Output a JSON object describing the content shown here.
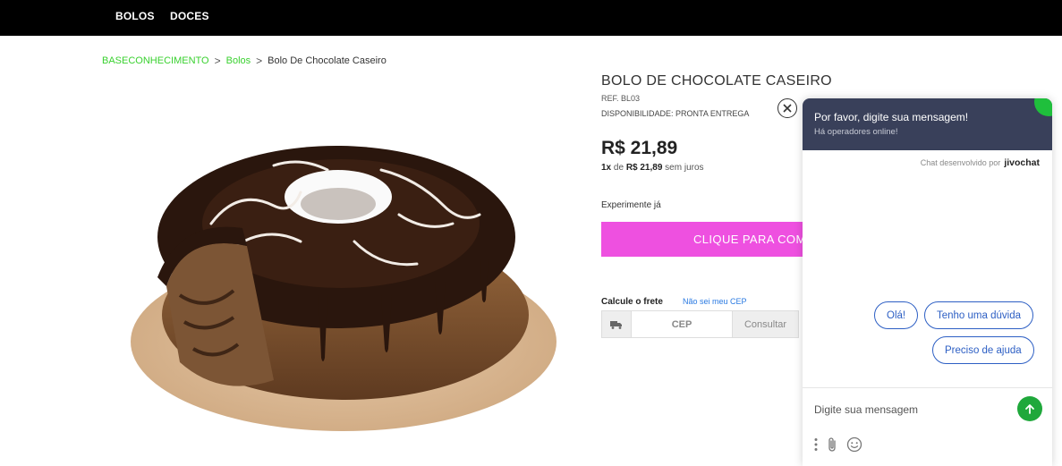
{
  "nav": {
    "items": [
      "BOLOS",
      "DOCES"
    ]
  },
  "breadcrumb": {
    "home": "BASECONHECIMENTO",
    "category": "Bolos",
    "current": "Bolo De Chocolate Caseiro",
    "separator": ">"
  },
  "product": {
    "title": "BOLO DE CHOCOLATE CASEIRO",
    "ref": "REF. BL03",
    "availability": "DISPONIBILIDADE: PRONTA ENTREGA",
    "price": "R$ 21,89",
    "install_prefix": "1x",
    "install_de": " de ",
    "install_value": "R$ 21,89",
    "install_suffix": " sem juros",
    "try_label": "Experimente já",
    "buy_label": "CLIQUE PARA COM"
  },
  "shipping": {
    "label": "Calcule o frete",
    "help_link": "Não sei meu CEP",
    "cep_placeholder": "CEP",
    "consult_label": "Consultar"
  },
  "chat": {
    "header_title": "Por favor, digite sua mensagem!",
    "header_subtitle": "Há operadores online!",
    "powered_by": "Chat desenvolvido por",
    "brand": "jivochat",
    "quick_replies": [
      "Olá!",
      "Tenho uma dúvida",
      "Preciso de ajuda"
    ],
    "input_placeholder": "Digite sua mensagem"
  },
  "colors": {
    "buy_button": "#ee50e0",
    "breadcrumb_link": "#39d12f",
    "chat_header": "#39405a",
    "chat_accent": "#2d5fc4",
    "send_button": "#1fa83b"
  },
  "icons": [
    "truck-icon",
    "close-icon",
    "send-arrow-icon",
    "menu-dots-icon",
    "paperclip-icon",
    "smiley-icon"
  ]
}
